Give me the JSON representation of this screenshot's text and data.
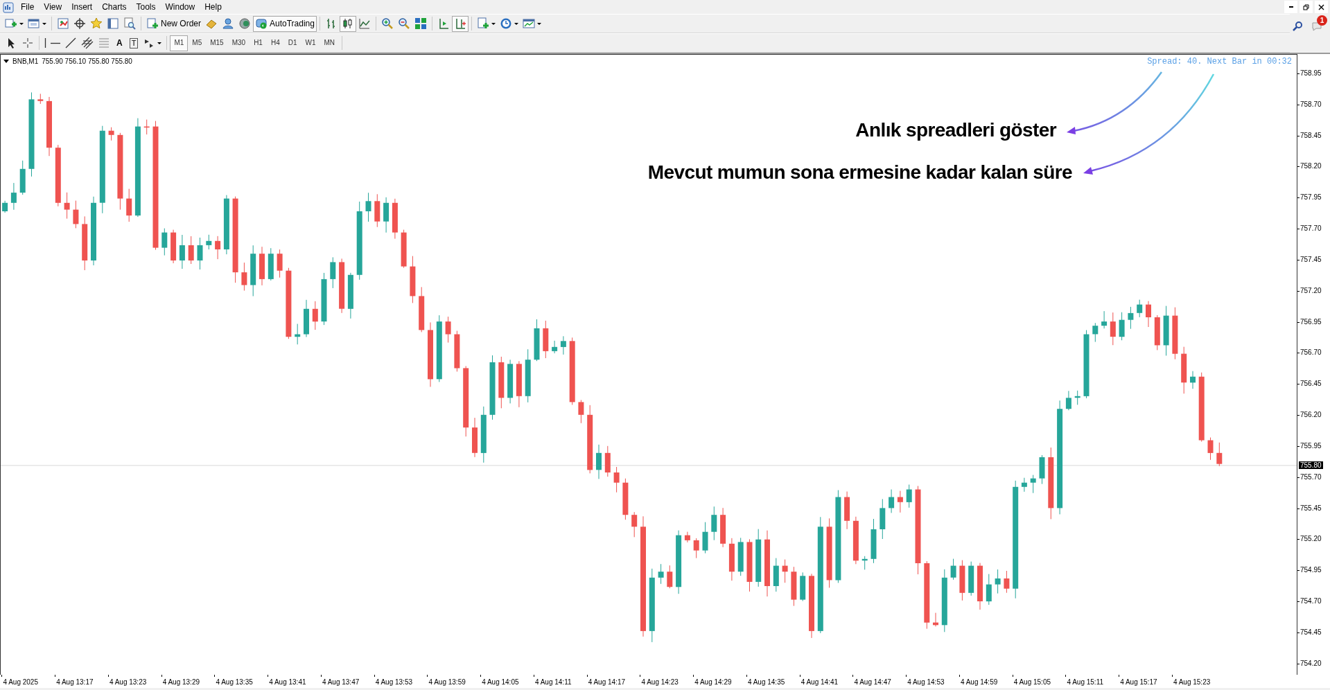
{
  "menu": [
    {
      "label": "File"
    },
    {
      "label": "View"
    },
    {
      "label": "Insert"
    },
    {
      "label": "Charts"
    },
    {
      "label": "Tools"
    },
    {
      "label": "Window"
    },
    {
      "label": "Help"
    }
  ],
  "toolbar": {
    "new_order": "New Order",
    "auto_trading": {
      "label": "AutoTrading",
      "pressed": true
    },
    "chart_types": [
      {
        "pressed": false
      },
      {
        "pressed": true
      },
      {
        "pressed": false
      }
    ],
    "auto_scroll": {
      "pressed": false
    },
    "chart_shift": {
      "pressed": true
    }
  },
  "drawing_tools": {
    "text_tool": "A",
    "text_label_tool": "T"
  },
  "timeframes": [
    {
      "label": "M1",
      "selected": true
    },
    {
      "label": "M5",
      "selected": false
    },
    {
      "label": "M15",
      "selected": false
    },
    {
      "label": "M30",
      "selected": false
    },
    {
      "label": "H1",
      "selected": false
    },
    {
      "label": "H4",
      "selected": false
    },
    {
      "label": "D1",
      "selected": false
    },
    {
      "label": "W1",
      "selected": false
    },
    {
      "label": "MN",
      "selected": false
    }
  ],
  "notifications": {
    "badge": "1"
  },
  "chart": {
    "symbol": "BNB,M1",
    "quote": "755.90 756.10 755.80 755.80",
    "info": "Spread: 40. Next Bar in 00:32",
    "current_price": "755.80",
    "price_axis": [
      "758.95",
      "758.70",
      "758.45",
      "758.20",
      "757.95",
      "757.70",
      "757.45",
      "757.20",
      "756.95",
      "756.70",
      "756.45",
      "756.20",
      "755.95",
      "755.70",
      "755.45",
      "755.20",
      "754.95",
      "754.70",
      "754.45",
      "754.20"
    ],
    "time_axis": [
      "4 Aug 2025",
      "4 Aug 13:17",
      "4 Aug 13:23",
      "4 Aug 13:29",
      "4 Aug 13:35",
      "4 Aug 13:41",
      "4 Aug 13:47",
      "4 Aug 13:53",
      "4 Aug 13:59",
      "4 Aug 14:05",
      "4 Aug 14:11",
      "4 Aug 14:17",
      "4 Aug 14:23",
      "4 Aug 14:29",
      "4 Aug 14:35",
      "4 Aug 14:41",
      "4 Aug 14:47",
      "4 Aug 14:53",
      "4 Aug 14:59",
      "4 Aug 15:05",
      "4 Aug 15:11",
      "4 Aug 15:17",
      "4 Aug 15:23"
    ],
    "annotations": [
      {
        "text": "Anlık spreadleri göster"
      },
      {
        "text": "Mevcut mumun sona ermesine kadar kalan süre"
      }
    ]
  }
}
